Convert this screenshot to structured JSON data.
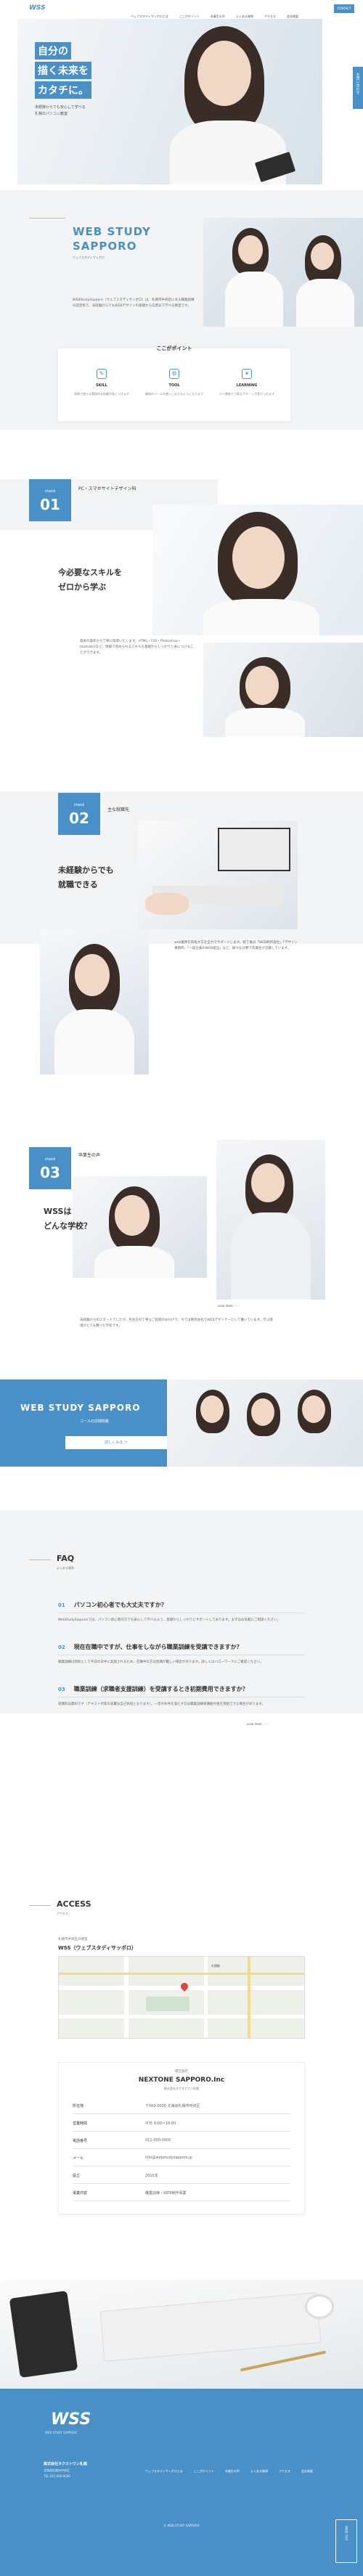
{
  "header": {
    "logo": "WSS",
    "logo_sub": "WEB STUDY SAPPORO",
    "nav": [
      "ウェブスタディサッポロとは",
      "ここがポイント",
      "卒業生の声",
      "よくある質問",
      "アクセス",
      "会社概要"
    ],
    "contact": "CONTACT",
    "side_tab": "お問い合わせ"
  },
  "hero": {
    "heading_lines": [
      "自分の",
      "描く未来を",
      "カタチに。"
    ],
    "sub": "未経験からでも安心して学べる",
    "sub2": "札幌のパソコン教室"
  },
  "about": {
    "title_lines": [
      "WEB STUDY",
      "SAPPORO"
    ],
    "kana": "ウェブスタディサッポロ",
    "body": "WEBStudySapporo（ウェブスタディサッポロ）は、札幌市中央区にある職業訓練の認定校で、未経験からでもWEBデザインの基礎から応用まで学べる教室です。",
    "points_title": "ここがポイント",
    "features": [
      {
        "icon": "✎",
        "label": "SKILL",
        "text": "現場で使える実践的な知識が身につきます"
      },
      {
        "icon": "⚙",
        "label": "TOOL",
        "text": "最新のツールを使いこなせるようになります"
      },
      {
        "icon": "✦",
        "label": "LEARNING",
        "text": "少人数制で丁寧なサポートが受けられます"
      }
    ]
  },
  "check01": {
    "label": "check",
    "num": "01",
    "tag": "PC・スマホサイトデザイン科",
    "heading_lines": [
      "今必要なスキルを",
      "ゼロから学ぶ"
    ],
    "body": "基本の操作から丁寧に指導いたします。HTML・CSS・Photoshop・Illustratorなど、現場で求められるスキルを基礎からしっかりと身につけることができます。"
  },
  "check02": {
    "label": "check",
    "num": "02",
    "tag": "主な就職先",
    "heading_lines": [
      "未経験からでも",
      "就職できる"
    ],
    "body": "web業界を目指す方を全力でサポートします。修了後は「WEB制作会社」「デザイン事務所」「一般企業のWEB担当」など、様々な分野で卒業生が活躍しています。"
  },
  "check03": {
    "label": "check",
    "num": "03",
    "tag": "卒業生の声",
    "heading_lines": [
      "WSSは",
      "どんな学校？"
    ],
    "body": "未経験からのスタートでしたが、先生方の丁寧なご指導のおかげで、今では制作会社でWEBデザイナーとして働いています。学ぶ環境がとても整った学校です。",
    "more": "view more"
  },
  "banner": {
    "title": "WEB STUDY SAPPORO",
    "sub": "コースの詳細情報",
    "button": "詳しくみる ＞"
  },
  "faq": {
    "title": "FAQ",
    "kana": "よくある質問",
    "items": [
      {
        "n": "01",
        "q": "パソコン初心者でも大丈夫ですか？",
        "a": "WebStudySapporoでは、パソコン初心者の方でも安心して学べるよう、基礎からしっかりとサポートしております。まずはお気軽にご相談ください。"
      },
      {
        "n": "02",
        "q": "現在在職中ですが、仕事をしながら職業訓練を受講できますか？",
        "a": "職業訓練は原則として平日の日中に実施されるため、在職中の方は受講が難しい場合があります。詳しくはハローワークにご確認ください。"
      },
      {
        "n": "03",
        "q": "職業訓練（求職者支援訓練）を受講するとき初期費用できますか？",
        "a": "受講料は無料です（テキスト代等の実費は自己負担となります）。一定の条件を満たす方は職業訓練受講給付金を受給できる場合があります。"
      }
    ],
    "more": "view more"
  },
  "access": {
    "title": "ACCESS",
    "kana": "アクセス",
    "school_label": "札幌市中央区の教室",
    "school_name": "WSS（ウェブスタディサッポロ）",
    "map_label": "札幌駅",
    "company_label": "運営会社",
    "company_name": "NEXTONE SAPPORO.Inc",
    "company_sub": "株式会社ネクストワン札幌",
    "rows": [
      {
        "k": "所在地",
        "v": "〒060-0000 北海道札幌市中央区"
      },
      {
        "k": "営業時間",
        "v": "平日 9:00〜18:00"
      },
      {
        "k": "電話番号",
        "v": "011-000-0000"
      },
      {
        "k": "メール",
        "v": "info@webstudysapporo.jp"
      },
      {
        "k": "設立",
        "v": "2015年"
      },
      {
        "k": "事業内容",
        "v": "職業訓練・WEB制作事業"
      }
    ]
  },
  "footer": {
    "logo": "WSS",
    "logo_sub": "WEB STUDY SAPPORO",
    "company": "株式会社ネクストワン札幌",
    "address": "北海道札幌市中央区",
    "tel": "TEL 011-000-0000",
    "nav": [
      "ウェブスタディサッポロとは",
      "ここがポイント",
      "卒業生の声",
      "よくある質問",
      "アクセス",
      "会社概要"
    ],
    "copyright": "© WEB STUDY SAPPORO",
    "pagetop": "PAGE TOP"
  }
}
